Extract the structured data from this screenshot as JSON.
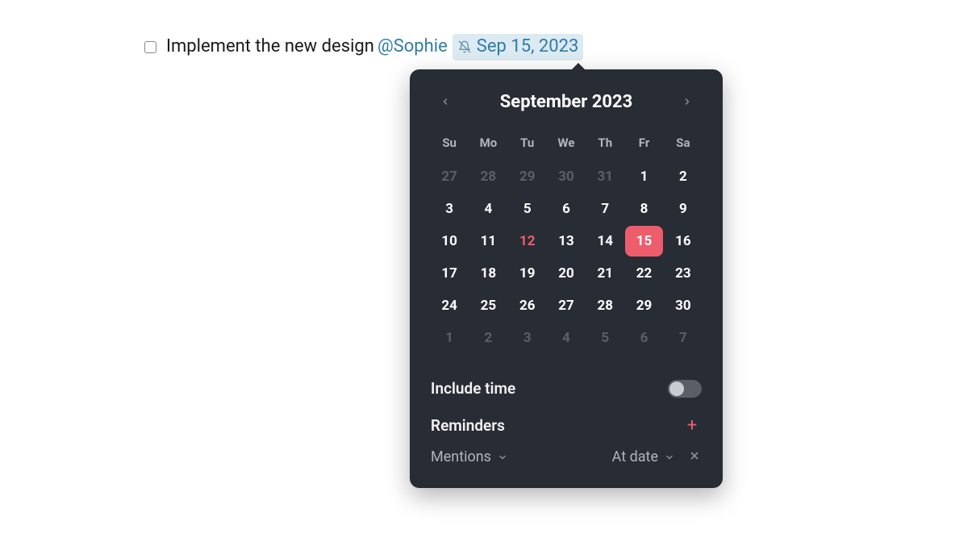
{
  "task": {
    "text": "Implement the new design",
    "mention": "@Sophie",
    "date_label": "Sep 15, 2023"
  },
  "datepicker": {
    "month_title": "September 2023",
    "dow": [
      "Su",
      "Mo",
      "Tu",
      "We",
      "Th",
      "Fr",
      "Sa"
    ],
    "cells": [
      {
        "d": "27",
        "other": true
      },
      {
        "d": "28",
        "other": true
      },
      {
        "d": "29",
        "other": true
      },
      {
        "d": "30",
        "other": true
      },
      {
        "d": "31",
        "other": true
      },
      {
        "d": "1"
      },
      {
        "d": "2"
      },
      {
        "d": "3"
      },
      {
        "d": "4"
      },
      {
        "d": "5"
      },
      {
        "d": "6"
      },
      {
        "d": "7"
      },
      {
        "d": "8"
      },
      {
        "d": "9"
      },
      {
        "d": "10"
      },
      {
        "d": "11"
      },
      {
        "d": "12",
        "today": true
      },
      {
        "d": "13"
      },
      {
        "d": "14"
      },
      {
        "d": "15",
        "selected": true
      },
      {
        "d": "16"
      },
      {
        "d": "17"
      },
      {
        "d": "18"
      },
      {
        "d": "19"
      },
      {
        "d": "20"
      },
      {
        "d": "21"
      },
      {
        "d": "22"
      },
      {
        "d": "23"
      },
      {
        "d": "24"
      },
      {
        "d": "25"
      },
      {
        "d": "26"
      },
      {
        "d": "27"
      },
      {
        "d": "28"
      },
      {
        "d": "29"
      },
      {
        "d": "30"
      },
      {
        "d": "1",
        "other": true
      },
      {
        "d": "2",
        "other": true
      },
      {
        "d": "3",
        "other": true
      },
      {
        "d": "4",
        "other": true
      },
      {
        "d": "5",
        "other": true
      },
      {
        "d": "6",
        "other": true
      },
      {
        "d": "7",
        "other": true
      }
    ],
    "include_time_label": "Include time",
    "reminders_label": "Reminders",
    "reminder_type": "Mentions",
    "reminder_when": "At date"
  }
}
